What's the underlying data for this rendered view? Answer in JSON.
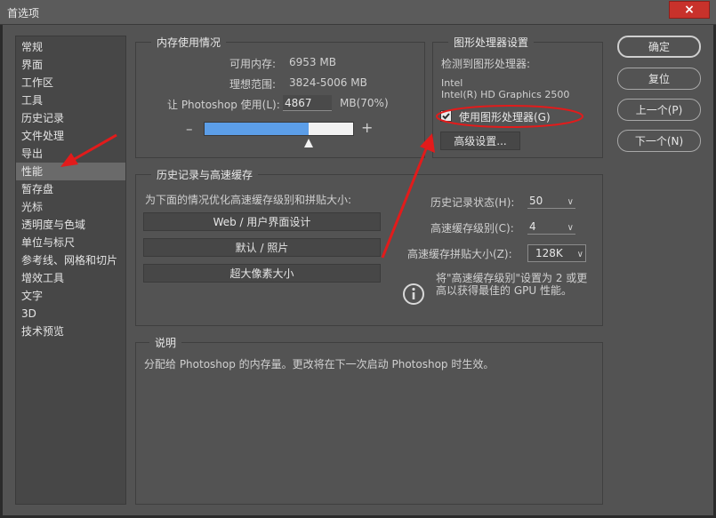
{
  "window": {
    "title": "首选项",
    "close_icon": "×"
  },
  "sidebar": {
    "items": [
      "常规",
      "界面",
      "工作区",
      "工具",
      "历史记录",
      "文件处理",
      "导出",
      "性能",
      "暂存盘",
      "光标",
      "透明度与色域",
      "单位与标尺",
      "参考线、网格和切片",
      "增效工具",
      "文字",
      "3D",
      "技术预览"
    ],
    "active": "性能"
  },
  "memory": {
    "title": "内存使用情况",
    "available_label": "可用内存:",
    "available_value": "6953 MB",
    "range_label": "理想范围:",
    "range_value": "3824-5006 MB",
    "use_label": "让 Photoshop 使用(L):",
    "use_value": "4867",
    "use_unit": "MB(70%)",
    "percent": 70,
    "minus": "–",
    "plus": "+"
  },
  "gpu": {
    "title": "图形处理器设置",
    "detected_label": "检测到图形处理器:",
    "vendor": "Intel",
    "model": "Intel(R) HD Graphics 2500",
    "use_gpu_label": "使用图形处理器(G)",
    "use_gpu_checked": true,
    "advanced_label": "高级设置..."
  },
  "history_cache": {
    "title": "历史记录与高速缓存",
    "optimize_label": "为下面的情况优化高速缓存级别和拼贴大小:",
    "buttons": [
      "Web / 用户界面设计",
      "默认 / 照片",
      "超大像素大小"
    ],
    "history_states_label": "历史记录状态(H):",
    "history_states_value": "50",
    "cache_levels_label": "高速缓存级别(C):",
    "cache_levels_value": "4",
    "tile_size_label": "高速缓存拼贴大小(Z):",
    "tile_size_value": "128K",
    "tip_line1": "将\"高速缓存级别\"设置为 2 或更",
    "tip_line2": "高以获得最佳的 GPU 性能。"
  },
  "description": {
    "title": "说明",
    "text": "分配给 Photoshop 的内存量。更改将在下一次启动 Photoshop 时生效。"
  },
  "actions": {
    "ok": "确定",
    "reset": "复位",
    "prev": "上一个(P)",
    "next": "下一个(N)"
  },
  "colors": {
    "accent": "#5c9ee8",
    "annotation_red": "#e21b1b",
    "close_red": "#c8322b"
  }
}
